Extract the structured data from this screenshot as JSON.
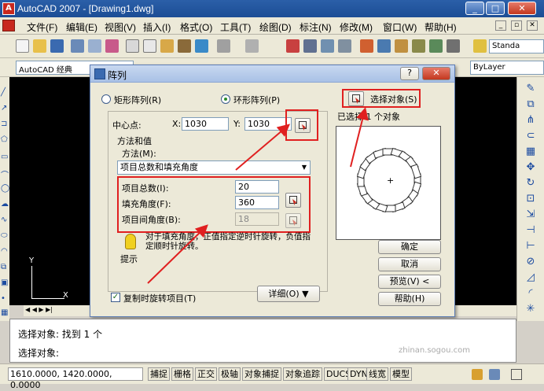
{
  "app": {
    "title": "AutoCAD 2007 - [Drawing1.dwg]"
  },
  "menubar": {
    "items": [
      "文件(F)",
      "编辑(E)",
      "视图(V)",
      "插入(I)",
      "格式(O)",
      "工具(T)",
      "绘图(D)",
      "标注(N)",
      "修改(M)",
      "窗口(W)",
      "帮助(H)"
    ]
  },
  "toolbar": {
    "workspace": "AutoCAD 经典",
    "text_style": "Standa",
    "layer": "ByLayer"
  },
  "dialog": {
    "title": "阵列",
    "help_btn": "?",
    "rect_array": "矩形阵列(R)",
    "polar_array": "环形阵列(P)",
    "center_label": "中心点:",
    "x_label": "X:",
    "x_value": "1030",
    "y_label": "Y:",
    "y_value": "1030",
    "method_group": "方法和值",
    "method_label": "方法(M):",
    "method_value": "项目总数和填充角度",
    "total_label": "项目总数(I):",
    "total_value": "20",
    "fill_label": "填充角度(F):",
    "fill_value": "360",
    "between_label": "项目间角度(B):",
    "between_value": "18",
    "tip_text": "对于填充角度，正值指定逆时针旋转，负值指定顺时针旋转。",
    "tip_label": "提示",
    "rotate_items": "复制时旋转项目(T)",
    "details": "详细(O) ▼",
    "select_objects": "选择对象(S)",
    "selected_count": "已选择 1 个对象",
    "ok": "确定",
    "cancel": "取消",
    "preview": "预览(V) <",
    "help": "帮助(H)"
  },
  "command": {
    "line1": "选择对象: 找到 1 个",
    "line2": "选择对象:"
  },
  "statusbar": {
    "coords": "1610.0000, 1420.0000, 0.0000",
    "toggles": [
      "捕捉",
      "栅格",
      "正交",
      "极轴",
      "对象捕捉",
      "对象追踪",
      "DUCS",
      "DYN",
      "线宽",
      "模型"
    ]
  },
  "drawing": {
    "axis_x": "X",
    "axis_y": "Y"
  },
  "watermark": {
    "text": "搜狗指南",
    "url": "zhinan.sogou.com"
  },
  "colors": {
    "highlight": "#e02020",
    "titlebar": "#2b5fa8"
  }
}
